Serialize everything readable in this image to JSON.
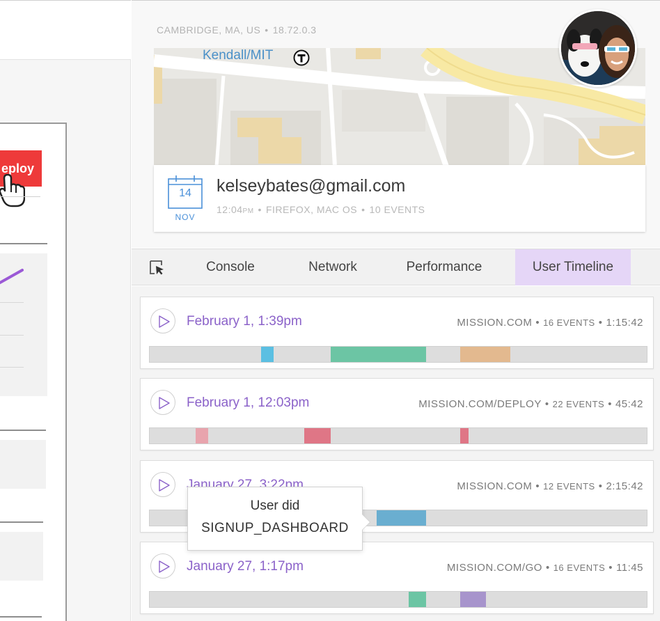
{
  "left_app": {
    "deploy_label": "eploy",
    "accent_color": "#ee3a3a",
    "chart_color": "#9b59d6"
  },
  "profile": {
    "location": "CAMBRIDGE, MA, US",
    "ip": "18.72.0.3",
    "map_label": "Kendall/MIT",
    "transit_icon": "transit-t-icon",
    "avatar": "user-avatar",
    "calendar": {
      "day": "14",
      "month": "NOV"
    },
    "email": "kelseybates@gmail.com",
    "session_time": "12:04",
    "session_time_suffix": "PM",
    "browser": "FIREFOX, MAC OS",
    "events": "10 EVENTS"
  },
  "tabs": {
    "inspect_icon": "cursor-select-icon",
    "console": "Console",
    "network": "Network",
    "performance": "Performance",
    "user_timeline": "User Timeline",
    "active_color": "#e5d6f7"
  },
  "sessions": [
    {
      "date": "February 1, 1:39pm",
      "site": "MISSION.COM",
      "events": "16 EVENTS",
      "duration": "1:15:42",
      "event_segments": [
        {
          "start": 0.224,
          "end": 0.249,
          "color": "#5bbfe2"
        },
        {
          "start": 0.364,
          "end": 0.556,
          "color": "#6cc5a4"
        },
        {
          "start": 0.624,
          "end": 0.725,
          "color": "#e3b98f"
        }
      ]
    },
    {
      "date": "February 1, 12:03pm",
      "site": "MISSION.COM/DEPLOY",
      "events": "22 EVENTS",
      "duration": "45:42",
      "event_segments": [
        {
          "start": 0.092,
          "end": 0.118,
          "color": "#e8a4ad"
        },
        {
          "start": 0.311,
          "end": 0.364,
          "color": "#df7686"
        },
        {
          "start": 0.624,
          "end": 0.641,
          "color": "#df7686"
        }
      ]
    },
    {
      "date": "January 27, 3:22pm",
      "site": "MISSION.COM",
      "events": "12 EVENTS",
      "duration": "2:15:42",
      "event_segments": [
        {
          "start": 0.457,
          "end": 0.556,
          "color": "#6aaed0"
        }
      ]
    },
    {
      "date": "January 27, 1:17pm",
      "site": "MISSION.COM/GO",
      "events": "16 EVENTS",
      "duration": "11:45",
      "event_segments": [
        {
          "start": 0.521,
          "end": 0.556,
          "color": "#6cc5a4"
        },
        {
          "start": 0.624,
          "end": 0.676,
          "color": "#a794cc"
        }
      ]
    }
  ],
  "tooltip": {
    "line1": "User did",
    "line2": "SIGNUP_DASHBOARD"
  }
}
